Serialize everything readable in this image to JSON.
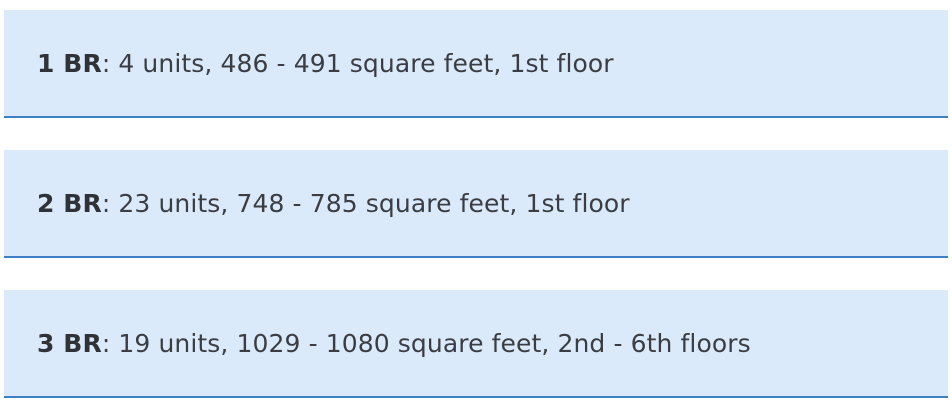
{
  "colors": {
    "row_background": "#dbeafb",
    "row_border": "#3e7fc6",
    "text": "#3a3e44"
  },
  "units": [
    {
      "type": "1 BR",
      "details": ": 4 units, 486 - 491 square feet, 1st floor"
    },
    {
      "type": "2 BR",
      "details": ": 23 units, 748 - 785 square feet, 1st floor"
    },
    {
      "type": "3 BR",
      "details": ": 19 units, 1029 - 1080 square feet, 2nd - 6th floors"
    }
  ]
}
